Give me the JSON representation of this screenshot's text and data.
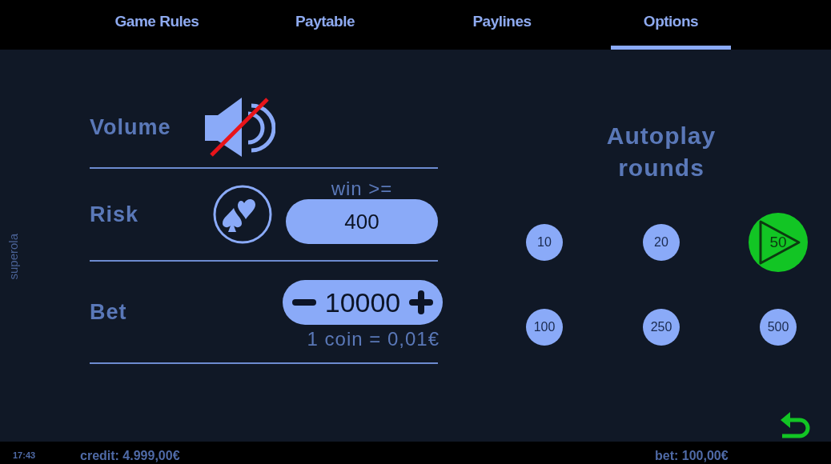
{
  "tabs": [
    {
      "label": "Game Rules",
      "selected": false
    },
    {
      "label": "Paytable",
      "selected": false
    },
    {
      "label": "Paylines",
      "selected": false
    },
    {
      "label": "Options",
      "selected": true
    }
  ],
  "side_label": "superola",
  "volume": {
    "label": "Volume",
    "muted": true
  },
  "risk": {
    "label": "Risk",
    "caption": "win >=",
    "value": "400"
  },
  "bet": {
    "label": "Bet",
    "value": "10000",
    "note": "1 coin = 0,01€"
  },
  "autoplay": {
    "title": "Autoplay rounds",
    "options": [
      {
        "label": "10",
        "selected": false
      },
      {
        "label": "20",
        "selected": false
      },
      {
        "label": "50",
        "selected": true
      },
      {
        "label": "100",
        "selected": false
      },
      {
        "label": "250",
        "selected": false
      },
      {
        "label": "500",
        "selected": false
      }
    ]
  },
  "status_bar": {
    "time": "17:43",
    "credit": "credit: 4.999,00€",
    "bet": "bet: 100,00€"
  }
}
